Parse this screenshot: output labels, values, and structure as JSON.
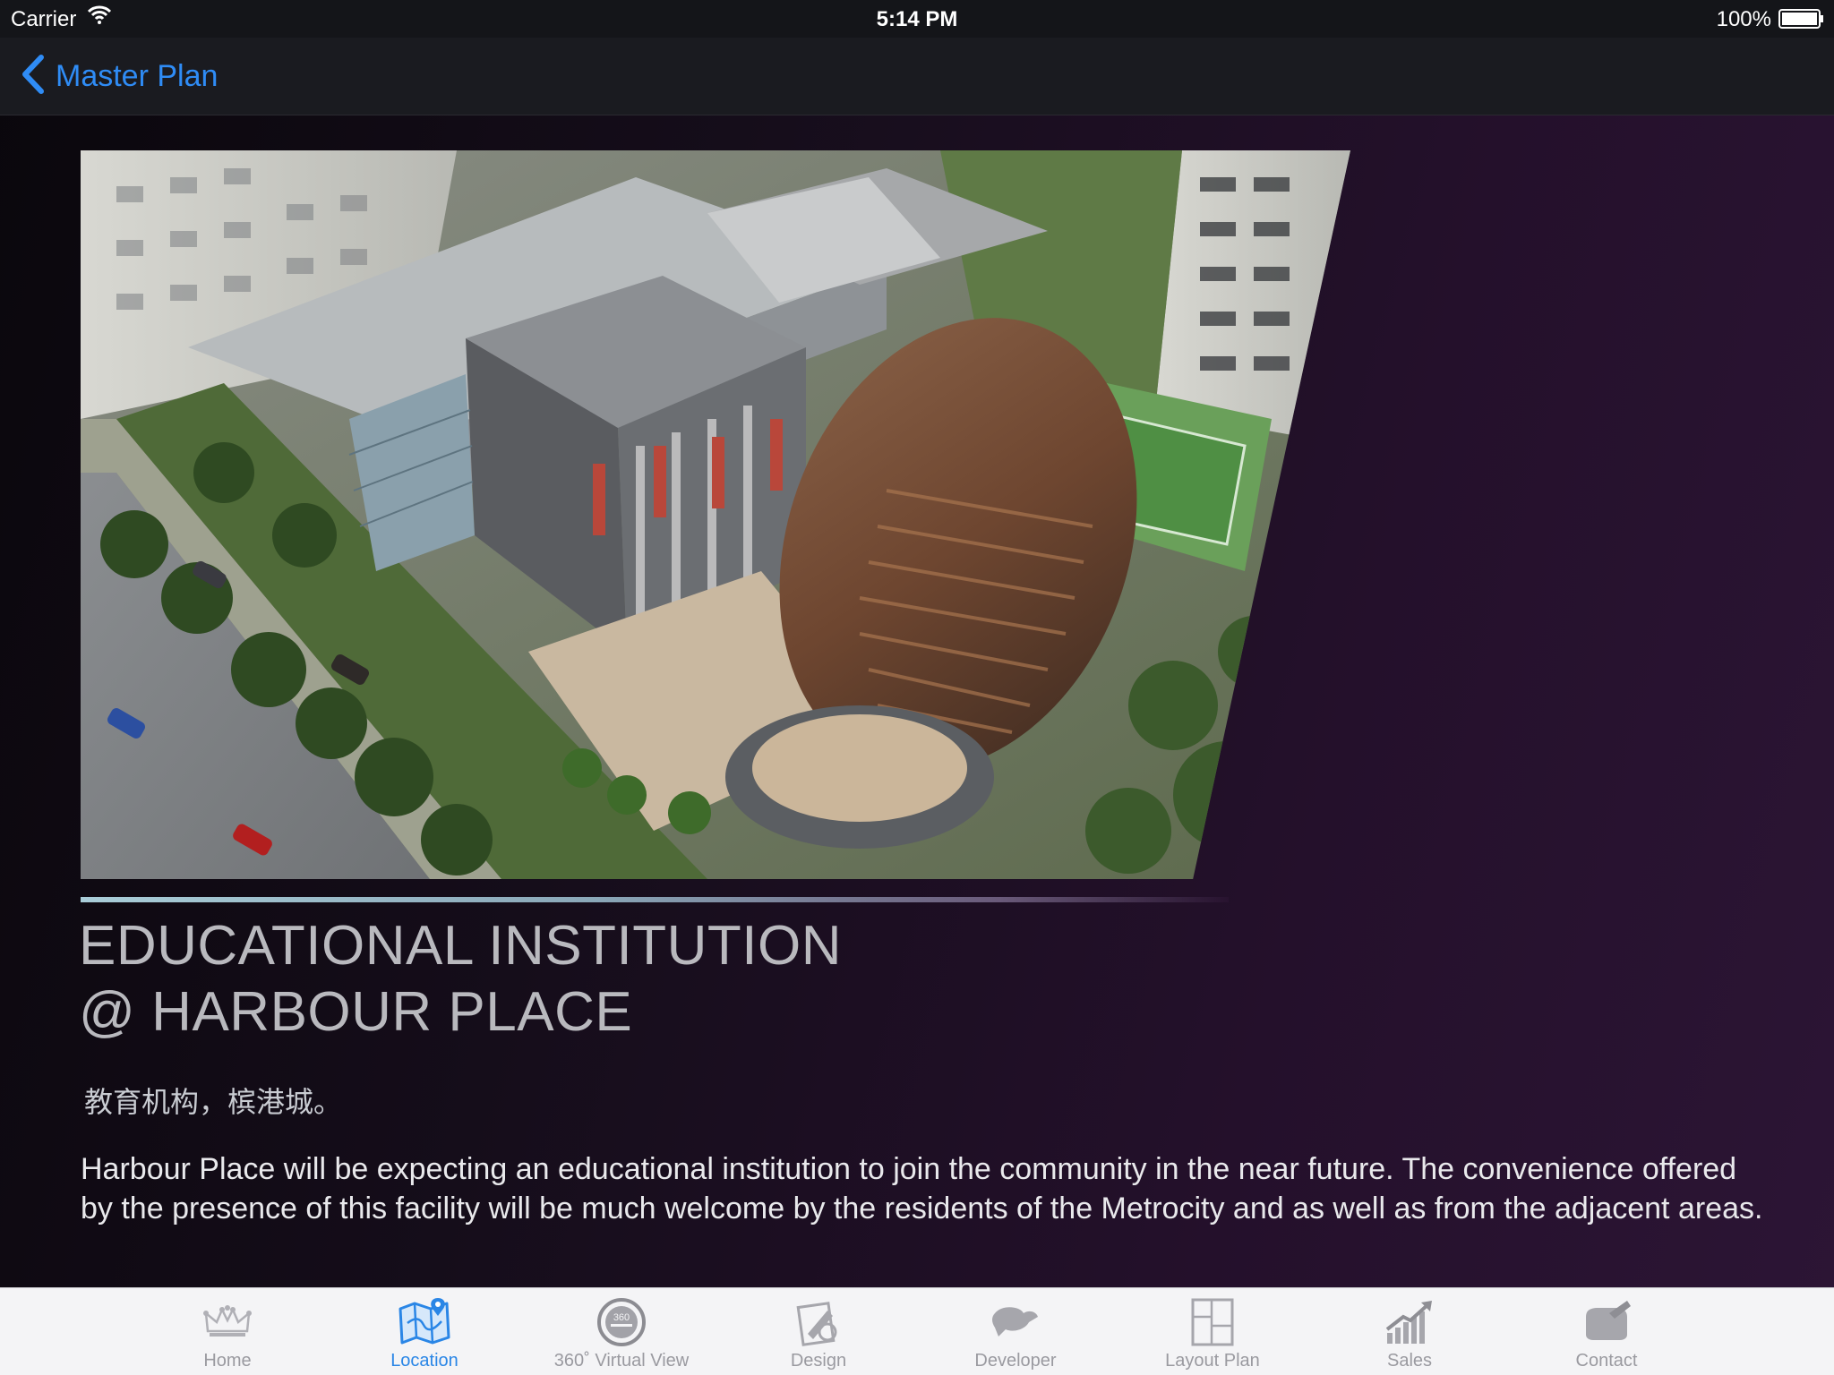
{
  "status_bar": {
    "carrier": "Carrier",
    "time": "5:14 PM",
    "battery": "100%"
  },
  "nav": {
    "back_label": "Master Plan",
    "accent_color": "#2f8cf5"
  },
  "content": {
    "title_line1": "EDUCATIONAL INSTITUTION",
    "title_line2": "@ HARBOUR PLACE",
    "subtitle_cn": "教育机构，槟港城。",
    "description": "Harbour Place will be expecting an educational institution to join the community in the near future. The convenience offered by the presence of this facility will be much welcome by the residents of the Metrocity and as well as from the adjacent areas."
  },
  "tab_bar": {
    "active_color": "#2a86e6",
    "tabs": [
      {
        "label": "Home",
        "icon": "crown-icon",
        "active": false
      },
      {
        "label": "Location",
        "icon": "map-icon",
        "active": true
      },
      {
        "label": "360˚ Virtual View",
        "icon": "virtual-view-icon",
        "active": false
      },
      {
        "label": "Design",
        "icon": "design-icon",
        "active": false
      },
      {
        "label": "Developer",
        "icon": "developer-icon",
        "active": false
      },
      {
        "label": "Layout Plan",
        "icon": "layout-plan-icon",
        "active": false
      },
      {
        "label": "Sales",
        "icon": "sales-chart-icon",
        "active": false
      },
      {
        "label": "Contact",
        "icon": "contact-icon",
        "active": false
      }
    ]
  }
}
